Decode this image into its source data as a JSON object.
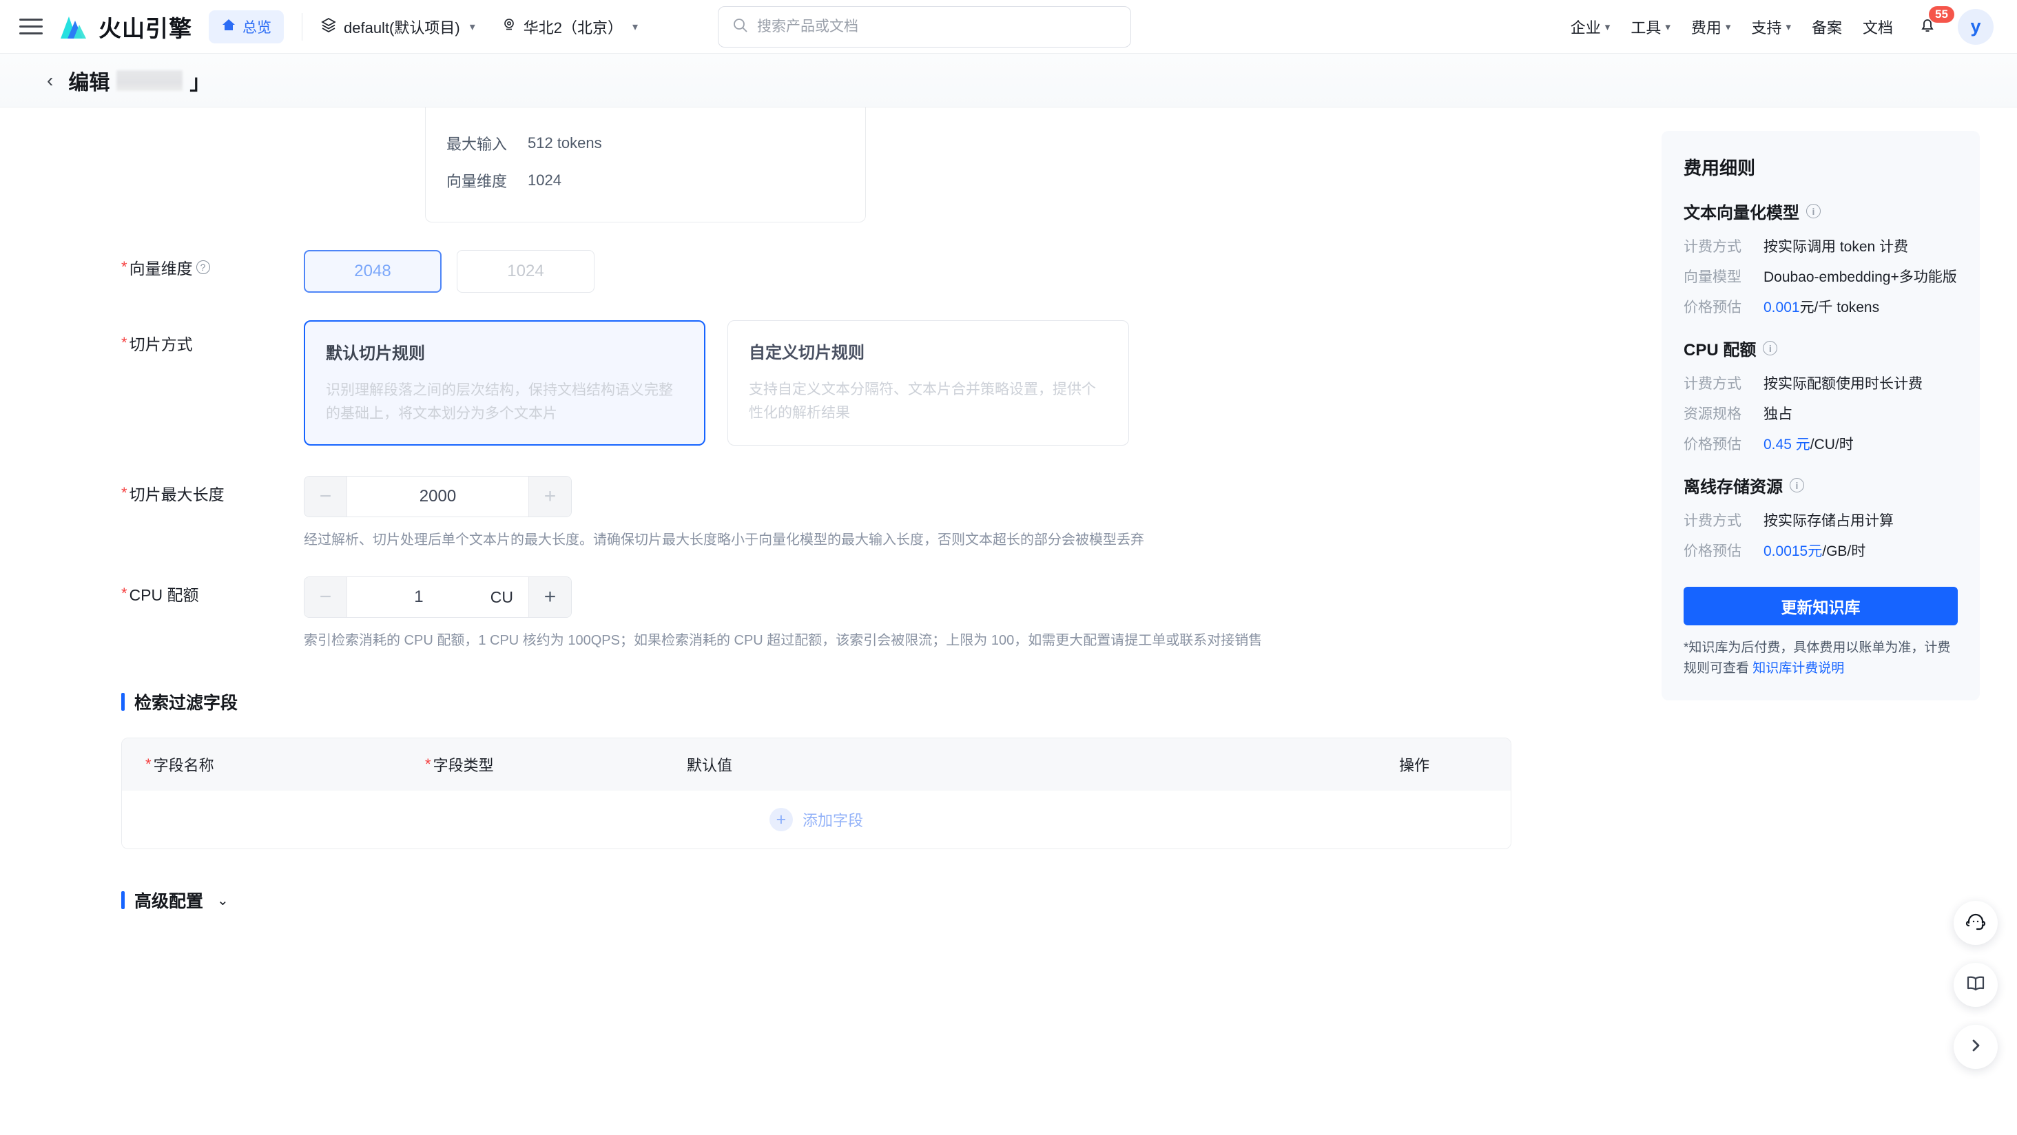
{
  "topnav": {
    "menu_icon": "hamburger-icon",
    "brand": "火山引擎",
    "overview_label": "总览",
    "project_label": "default(默认项目)",
    "region_label": "华北2（北京）",
    "search_placeholder": "搜索产品或文档",
    "search_value": "",
    "links": [
      {
        "label": "企业",
        "caret": true
      },
      {
        "label": "工具",
        "caret": true
      },
      {
        "label": "费用",
        "caret": true
      },
      {
        "label": "支持",
        "caret": true
      },
      {
        "label": "备案",
        "caret": false
      },
      {
        "label": "文档",
        "caret": false
      }
    ],
    "notification_count": "55",
    "avatar_initial": "y"
  },
  "pagehead": {
    "back": "‹",
    "title_prefix": "编辑",
    "title_suffix": "」"
  },
  "model_info": {
    "rows": [
      {
        "key": "最大输入",
        "value": "512 tokens"
      },
      {
        "key": "向量维度",
        "value": "1024"
      }
    ]
  },
  "vector_dim": {
    "label": "向量维度",
    "required": true,
    "options": [
      {
        "label": "2048",
        "state": "selected"
      },
      {
        "label": "1024",
        "state": "disabled"
      }
    ]
  },
  "chunk_method": {
    "label": "切片方式",
    "required": true,
    "cards": [
      {
        "title": "默认切片规则",
        "desc": "识别理解段落之间的层次结构，保持文档结构语义完整的基础上，将文本划分为多个文本片",
        "state": "selected"
      },
      {
        "title": "自定义切片规则",
        "desc": "支持自定义文本分隔符、文本片合并策略设置，提供个性化的解析结果",
        "state": "unselected"
      }
    ]
  },
  "chunk_length": {
    "label": "切片最大长度",
    "required": true,
    "value": "2000",
    "minus": "−",
    "plus": "+",
    "hint": "经过解析、切片处理后单个文本片的最大长度。请确保切片最大长度略小于向量化模型的最大输入长度，否则文本超长的部分会被模型丢弃"
  },
  "cpu_quota": {
    "label": "CPU 配额",
    "required": true,
    "value": "1",
    "unit": "CU",
    "minus": "−",
    "plus": "+",
    "hint": "索引检索消耗的 CPU 配额，1 CPU 核约为 100QPS；如果检索消耗的 CPU 超过配额，该索引会被限流；上限为 100，如需更大配置请提工单或联系对接销售"
  },
  "filter_fields": {
    "section_title": "检索过滤字段",
    "columns": [
      {
        "label": "字段名称",
        "required": true
      },
      {
        "label": "字段类型",
        "required": true
      },
      {
        "label": "默认值",
        "required": false
      },
      {
        "label": "操作",
        "required": false
      }
    ],
    "rows": [],
    "add_label": "添加字段",
    "add_icon": "plus-icon"
  },
  "advanced": {
    "section_title": "高级配置",
    "caret": "⌄"
  },
  "sidebar": {
    "title": "费用细则",
    "groups": [
      {
        "heading": "文本向量化模型",
        "rows": [
          {
            "key": "计费方式",
            "value": "按实际调用 token 计费",
            "highlight": false
          },
          {
            "key": "向量模型",
            "value": "Doubao-embedding+多功能版",
            "highlight": false
          },
          {
            "key": "价格预估",
            "value_blue": "0.001",
            "value_rest": "元/千 tokens",
            "highlight": true
          }
        ]
      },
      {
        "heading": "CPU 配额",
        "rows": [
          {
            "key": "计费方式",
            "value": "按实际配额使用时长计费",
            "highlight": false
          },
          {
            "key": "资源规格",
            "value": "独占",
            "highlight": false
          },
          {
            "key": "价格预估",
            "value_blue": "0.45 元",
            "value_rest": "/CU/时",
            "highlight": true
          }
        ]
      },
      {
        "heading": "离线存储资源",
        "rows": [
          {
            "key": "计费方式",
            "value": "按实际存储占用计算",
            "highlight": false
          },
          {
            "key": "价格预估",
            "value_blue": "0.0015元",
            "value_rest": "/GB/时",
            "highlight": true
          }
        ]
      }
    ],
    "primary_button": "更新知识库",
    "note_prefix": "*知识库为后付费，具体费用以账单为准，计费规则可查看 ",
    "note_link": "知识库计费说明"
  },
  "float_buttons": [
    {
      "icon": "headset-icon"
    },
    {
      "icon": "book-icon"
    },
    {
      "icon": "chevron-right-icon"
    }
  ],
  "colors": {
    "accent": "#1664ff",
    "accent_soft": "#eaf1ff",
    "danger": "#f53f3f",
    "badge": "#f5554a"
  }
}
